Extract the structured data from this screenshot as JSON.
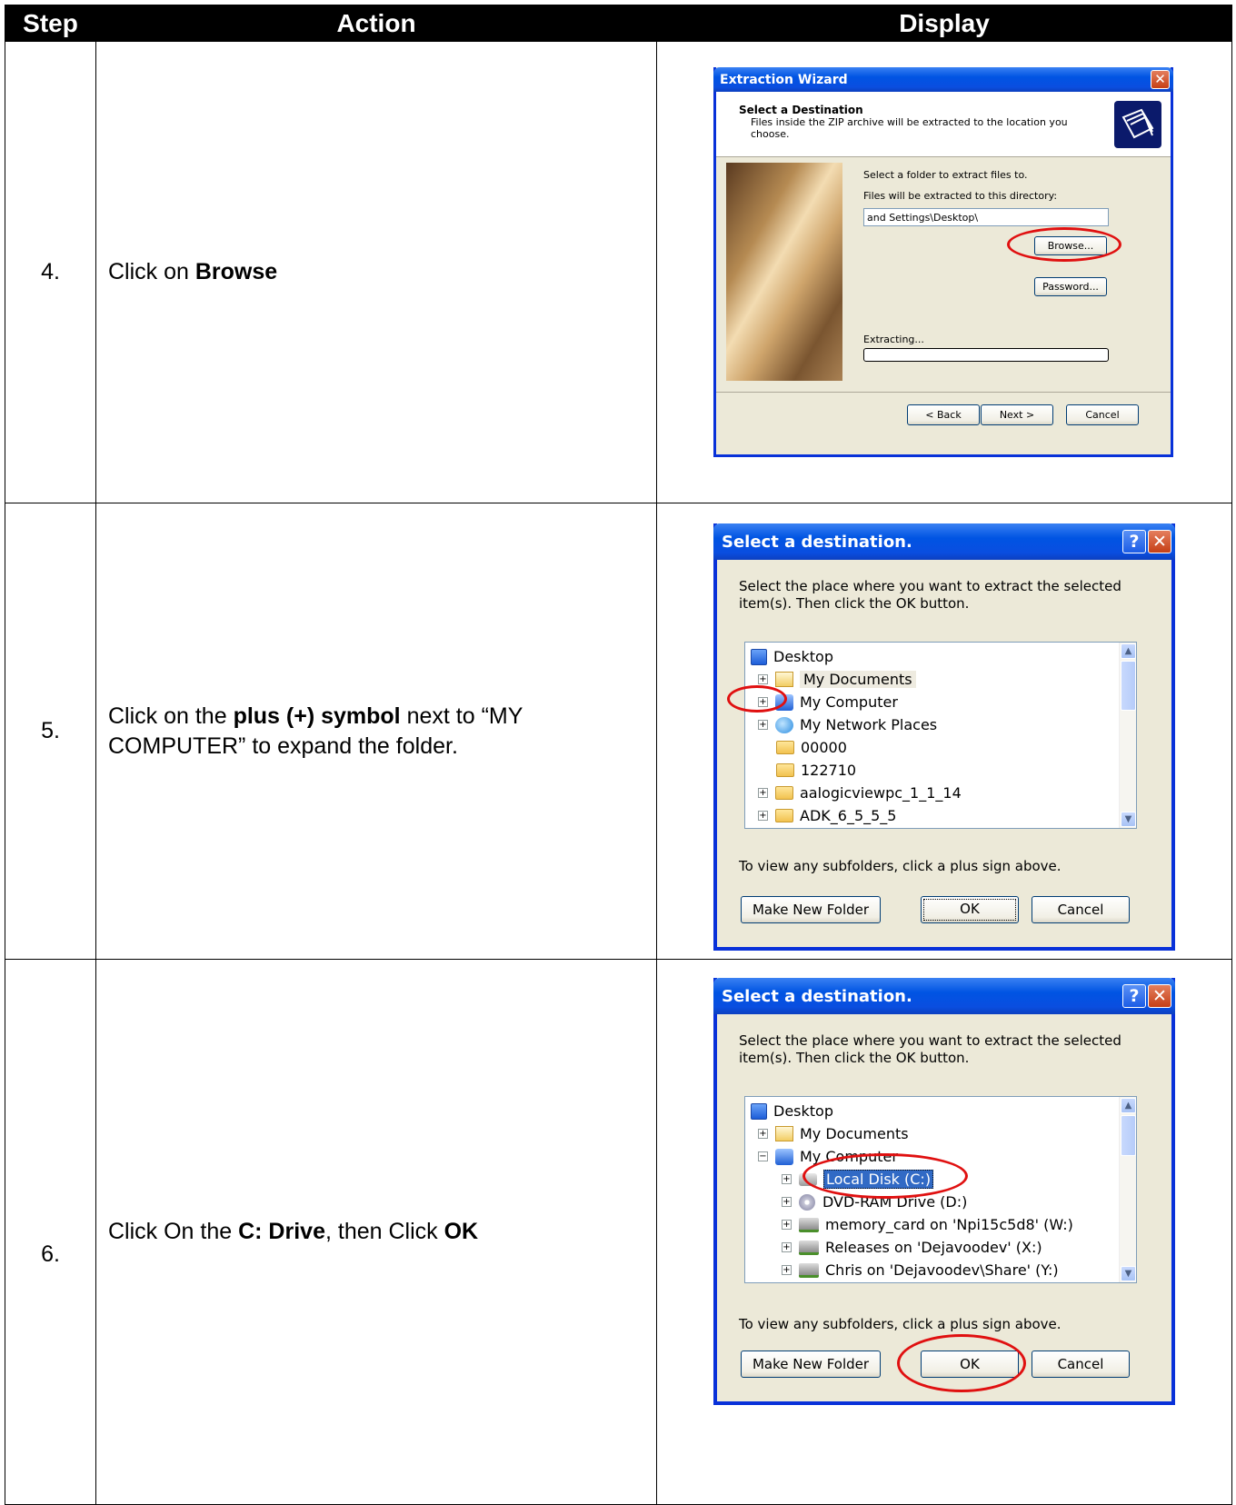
{
  "table": {
    "headers": {
      "step": "Step",
      "action": "Action",
      "display": "Display"
    },
    "rows": [
      {
        "step": "4.",
        "action_prefix": "Click on ",
        "action_bold": "Browse"
      },
      {
        "step": "5.",
        "action_prefix": "Click on the ",
        "action_bold": "plus (+) symbol",
        "action_suffix": " next to “MY COMPUTER” to expand the folder."
      },
      {
        "step": "6.",
        "action_prefix": "Click On the ",
        "action_bold": "C: Drive",
        "action_middle": ", then Click ",
        "action_bold2": "OK"
      }
    ]
  },
  "wizard": {
    "title": "Extraction Wizard",
    "heading": "Select a Destination",
    "subheading": "Files inside the ZIP archive will be extracted to the location you choose.",
    "select_folder": "Select a folder to extract files to.",
    "files_extracted": "Files will be extracted to this directory:",
    "path_value": "and Settings\\Desktop\\",
    "browse": "Browse...",
    "password": "Password...",
    "extracting": "Extracting...",
    "back": "< Back",
    "next": "Next >",
    "cancel": "Cancel"
  },
  "dest1": {
    "title": "Select a destination.",
    "instructions": "Select the place where you want to extract the selected item(s).  Then click the OK button.",
    "tree": [
      "Desktop",
      "My Documents",
      "My Computer",
      "My Network Places",
      "00000",
      "122710",
      "aalogicviewpc_1_1_14",
      "ADK_6_5_5_5"
    ],
    "hint": "To view any subfolders, click a plus sign above.",
    "make_new_folder": "Make New Folder",
    "ok": "OK",
    "cancel": "Cancel"
  },
  "dest2": {
    "title": "Select a destination.",
    "instructions": "Select the place where you want to extract the selected item(s).  Then click the OK button.",
    "tree": [
      "Desktop",
      "My Documents",
      "My Computer",
      "Local Disk (C:)",
      "DVD-RAM Drive (D:)",
      "memory_card on 'Npi15c5d8' (W:)",
      "Releases on 'Dejavoodev' (X:)",
      "Chris on 'Dejavoodev\\Share' (Y:)"
    ],
    "hint": "To view any subfolders, click a plus sign above.",
    "make_new_folder": "Make New Folder",
    "ok": "OK",
    "cancel": "Cancel"
  },
  "colors": {
    "annotation_ring": "#e01010",
    "xp_title_blue": "#0054e3",
    "dialog_face": "#ece9d8"
  }
}
